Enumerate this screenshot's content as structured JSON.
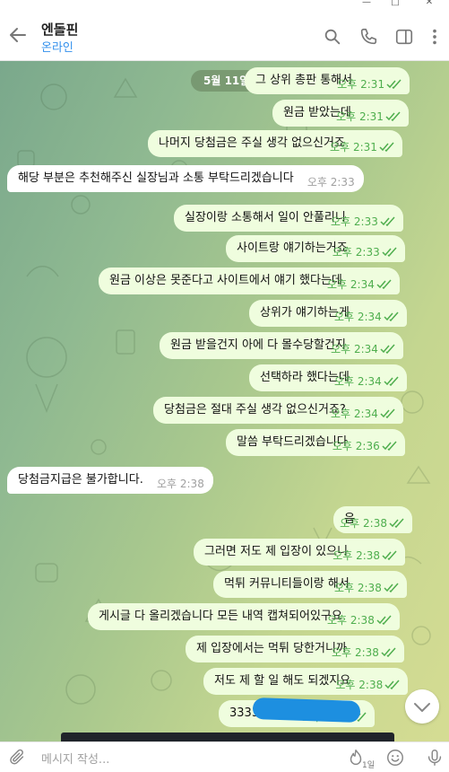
{
  "header": {
    "title": "엔돌핀",
    "status": "온라인"
  },
  "chat": {
    "date_badge": "5월 11일",
    "messages": [
      {
        "dir": "out",
        "text": "그 상위 총판 통해서",
        "time": "오후 2:31"
      },
      {
        "dir": "out",
        "text": "원금 받았는데",
        "time": "오후 2:31"
      },
      {
        "dir": "out",
        "text": "나머지 당첨금은 주실 생각 없으신거죠",
        "time": "오후 2:31"
      },
      {
        "dir": "in",
        "text": "해당 부분은 추천해주신 실장님과 소통 부탁드리겠습니다",
        "time": "오후 2:33"
      },
      {
        "dir": "out",
        "text": "실장이랑 소통해서 일이 안풀리니",
        "time": "오후 2:33"
      },
      {
        "dir": "out",
        "text": "사이트랑 얘기하는거죠",
        "time": "오후 2:33"
      },
      {
        "dir": "out",
        "text": "원금 이상은 못준다고 사이트에서 얘기 했다는데",
        "time": "오후 2:34"
      },
      {
        "dir": "out",
        "text": "상위가 얘기하는게",
        "time": "오후 2:34"
      },
      {
        "dir": "out",
        "text": "원금 받을건지 아에 다 몰수당할건지",
        "time": "오후 2:34"
      },
      {
        "dir": "out",
        "text": "선택하라 했다는데",
        "time": "오후 2:34"
      },
      {
        "dir": "out",
        "text": "당첨금은 절대 주실 생각 없으신거죠?",
        "time": "오후 2:34"
      },
      {
        "dir": "out",
        "text": "말씀 부탁드리겠습니다",
        "time": "오후 2:36"
      },
      {
        "dir": "in",
        "text": "당첨금지급은 불가합니다.",
        "time": "오후 2:38"
      },
      {
        "dir": "out",
        "text": "음",
        "time": "오후 2:38"
      },
      {
        "dir": "out",
        "text": "그러면 저도 제 입장이 있으니",
        "time": "오후 2:38"
      },
      {
        "dir": "out",
        "text": "먹튀 커뮤니티들이랑 해서",
        "time": "오후 2:38"
      },
      {
        "dir": "out",
        "text": "게시글 다 올리겠습니다 모든 내역 캡쳐되어있구요",
        "time": "오후 2:38"
      },
      {
        "dir": "out",
        "text": "제 입장에서는 먹튀 당한거니까",
        "time": "오후 2:38"
      },
      {
        "dir": "out",
        "text": "저도 제 할 일 해도 되겠지요",
        "time": "오후 2:38"
      },
      {
        "dir": "out",
        "text": "3333-2",
        "time": "오후 2:38"
      }
    ]
  },
  "composer": {
    "placeholder": "메시지 작성...",
    "timer_label": "1일"
  },
  "colors": {
    "accent": "#3390ec",
    "outgoing_bubble": "#effdde",
    "incoming_bubble": "#ffffff",
    "check": "#4fae4e"
  },
  "icons": [
    "back-arrow-icon",
    "search-icon",
    "phone-icon",
    "sidebar-icon",
    "more-icon",
    "paperclip-icon",
    "timer-icon",
    "emoji-icon",
    "microphone-icon",
    "chevron-down-icon",
    "checkmarks-icon"
  ]
}
